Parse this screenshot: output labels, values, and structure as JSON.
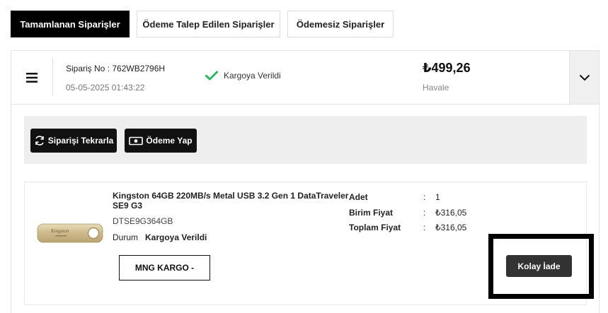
{
  "tabs": [
    {
      "label": "Tamamlanan Siparişler",
      "active": true
    },
    {
      "label": "Ödeme Talep Edilen Siparişler",
      "active": false
    },
    {
      "label": "Ödemesiz Siparişler",
      "active": false
    }
  ],
  "order": {
    "order_no_text": "Sipariş No : 762WB2796H",
    "date": "05-05-2025 01:43:22",
    "status": "Kargoya Verildi",
    "total": "₺499,26",
    "payment_method": "Havale",
    "actions": {
      "reorder_label": "Siparişi Tekrarla",
      "pay_label": "Ödeme Yap"
    },
    "item": {
      "brand_on_image": "Kingston",
      "title": "Kingston 64GB 220MB/s Metal USB 3.2 Gen 1 DataTraveler SE9 G3",
      "sku": "DTSE9G364GB",
      "status_label": "Durum",
      "status_value": "Kargoya Verildi",
      "cargo_label": "MNG KARGO -",
      "details": [
        {
          "label": "Adet",
          "value": "1"
        },
        {
          "label": "Birim Fiyat",
          "value": "₺316,05"
        },
        {
          "label": "Toplam Fiyat",
          "value": "₺316,05"
        }
      ],
      "return_label": "Kolay İade"
    }
  },
  "colors": {
    "primary": "#000000",
    "check_green": "#2fb463",
    "action_bar_bg": "#eeeeee",
    "return_button": "#333333"
  },
  "icons": {
    "menu": "hamburger-icon",
    "status": "check-icon",
    "toggle": "chevron-down-icon",
    "reorder": "refresh-icon",
    "pay": "cash-icon"
  }
}
